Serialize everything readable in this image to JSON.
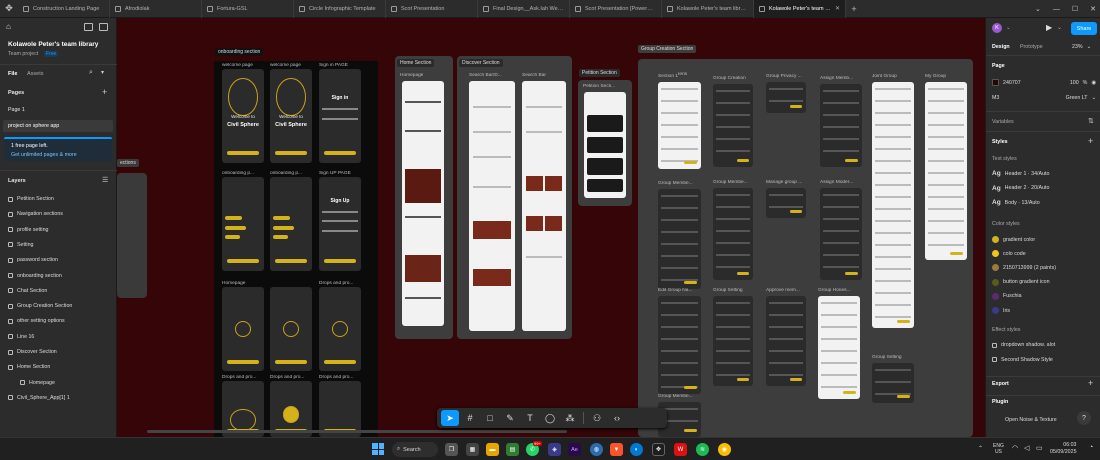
{
  "tabs": [
    {
      "label": "Construction Landing Page",
      "active": false
    },
    {
      "label": "Afrodiolak",
      "active": false
    },
    {
      "label": "Fortura-GSL",
      "active": false
    },
    {
      "label": "Circle Infographic Template",
      "active": false
    },
    {
      "label": "Scot Presentation",
      "active": false
    },
    {
      "label": "Final Design__Ask.Iah Web and Mob",
      "active": false
    },
    {
      "label": "Scot Presentation [PowerPoint] (01-",
      "active": false
    },
    {
      "label": "Kolawole Peter's team library - proje",
      "active": false
    },
    {
      "label": "Kolawole Peter's team library",
      "active": true
    }
  ],
  "left": {
    "file_title": "Kolawole Peter's team library",
    "subtitle": "Team project",
    "badge": "Free",
    "tab_file": "File",
    "tab_assets": "Assets",
    "pages_header": "Pages",
    "pages": [
      "Page 1",
      "project on sphere app"
    ],
    "free_notice": "1 free page left.",
    "upgrade_link": "Get unlimited pages & more",
    "layers_header": "Layers",
    "layers": [
      "Petition Section",
      "Navigation sections",
      "profile setting",
      "Setting",
      "password section",
      "onboarding section",
      "Chat Section",
      "Group Creation Section",
      "other setting options",
      "Line 16",
      "Discover Section",
      "Home Section",
      "Homepage",
      "Civil_Sphere_App[1] 1"
    ]
  },
  "canvas": {
    "sections": {
      "onboarding": "onboarding section",
      "home": "Home Section",
      "discover": "Discover Section",
      "petition": "Petition Section",
      "group": "Group Creation Section",
      "nav": "ections"
    },
    "onboarding_labels": [
      "welcome page",
      "welcome page",
      "Sign in PAGE",
      "onboarding p...",
      "onboarding p...",
      "Sign UP PAGE",
      "Homepage",
      "",
      "Drops and pro...",
      "Drops and pro...",
      "Drops and pro...",
      "Drops and pro..."
    ],
    "phone_text": {
      "welcome": "Welcome to",
      "brand": "Civil Sphere",
      "sign_in": "Sign in",
      "sign_up": "Sign Up"
    },
    "home_labels": [
      "Homepage"
    ],
    "discover_labels": [
      "Search Bar/D...",
      "Search Bar"
    ],
    "petition_labels": [
      "Petition Secti..."
    ],
    "group_row1": [
      "Section 1",
      "Iens",
      "Group Creation",
      "Group Privacy ...",
      "Assign Memb...",
      "Joint Group",
      "My Group"
    ],
    "group_row2": [
      "Group Membe...",
      "Group Membe...",
      "Manage group ...",
      "Assign Moder..."
    ],
    "group_row3": [
      "Edit Group Na...",
      "Group Setting",
      "Approve mem...",
      "Group Hones...",
      "Group Setting"
    ],
    "group_row4": [
      "Group Membe..."
    ]
  },
  "right": {
    "avatar": "K",
    "share": "Share",
    "tab_design": "Design",
    "tab_prototype": "Prototype",
    "zoom": "23%",
    "page_header": "Page",
    "page_color": "240707",
    "page_opacity": "100",
    "page_percent": "%",
    "m3": "M3",
    "green_lt": "Green LT",
    "variables": "Variables",
    "styles": "Styles",
    "text_styles_header": "Text styles",
    "text_styles": [
      "Header 1 · 34/Auto",
      "Header 2 · 20/Auto",
      "Body · 13/Auto"
    ],
    "color_styles_header": "Color styles",
    "color_styles": [
      {
        "name": "gradient color",
        "color": "#d4b21b"
      },
      {
        "name": "colo code",
        "color": "#f0c419"
      },
      {
        "name": "2150713999 (2 paints)",
        "color": "#9c7a3a"
      },
      {
        "name": "button gradient icon",
        "color": "#5a5a1a"
      },
      {
        "name": "Fuschia",
        "color": "#5c2a6e"
      },
      {
        "name": "Iris",
        "color": "#3a3a8a"
      }
    ],
    "effect_styles_header": "Effect styles",
    "effect_styles": [
      "dropdown shadow. alot",
      "Second Shadow Style"
    ],
    "export": "Export",
    "plugin": "Plugin",
    "plugin_item": "Open Noise & Texture",
    "help": "?"
  },
  "taskbar": {
    "search": "Search",
    "lang": "ENG",
    "lang_sub": "US",
    "time": "06:03",
    "date": "05/09/2025",
    "badge": "99+"
  },
  "colors": {
    "accent": "#0d99ff",
    "canvas": "#350508",
    "gold": "#d4b21b"
  }
}
